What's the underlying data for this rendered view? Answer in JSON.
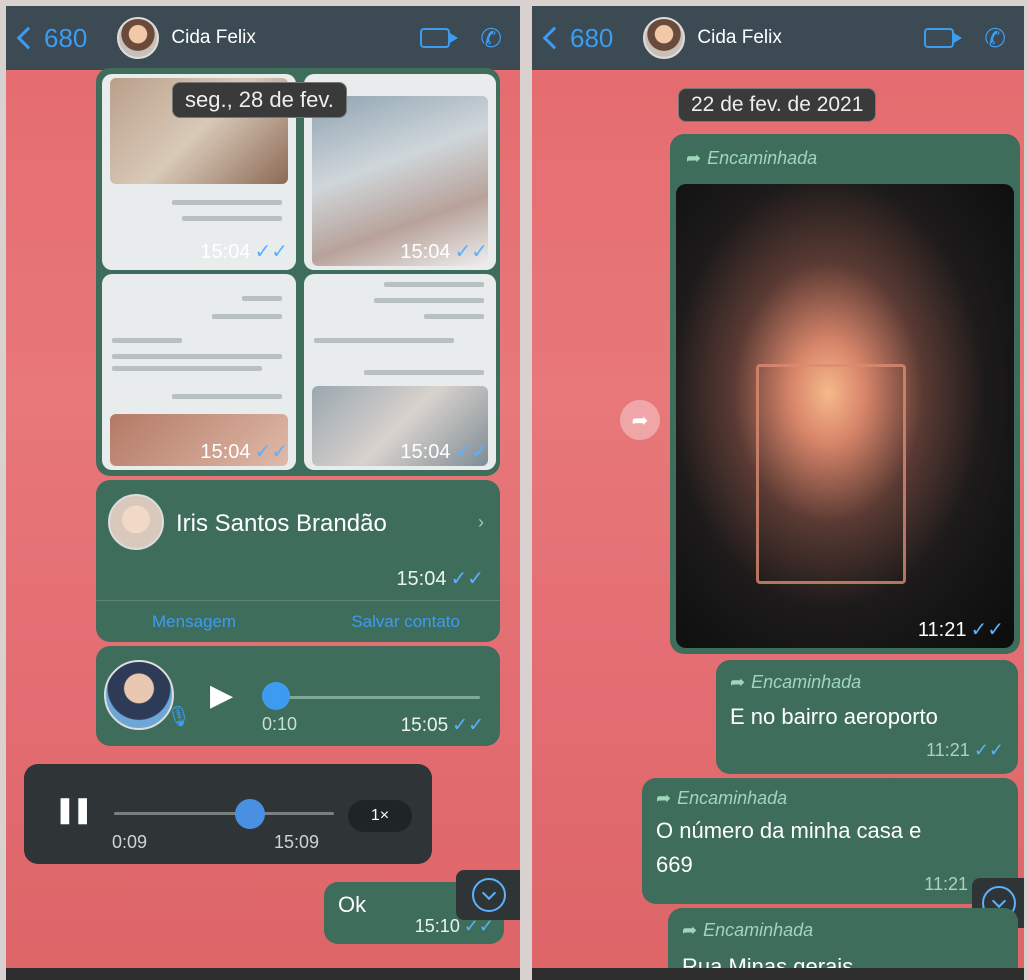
{
  "header": {
    "back_count": "680",
    "contact_name": "Cida Felix"
  },
  "left": {
    "date_pill": "seg., 28 de fev.",
    "grid_times": [
      "15:04",
      "15:04",
      "15:04",
      "15:04"
    ],
    "contact_card": {
      "name": "Iris Santos Brandão",
      "time": "15:04",
      "message_btn": "Mensagem",
      "save_btn": "Salvar contato"
    },
    "voice_in": {
      "duration": "0:10",
      "time": "15:05"
    },
    "voice_out": {
      "elapsed": "0:09",
      "time": "15:09",
      "speed": "1×",
      "progress": 0.62
    },
    "ok_msg": {
      "text": "Ok",
      "time": "15:10"
    }
  },
  "right": {
    "date_pill": "22 de fev. de 2021",
    "forwarded_label": "Encaminhada",
    "photo_time": "11:21",
    "msg1": {
      "text": "E no bairro aeroporto",
      "time": "11:21"
    },
    "msg2": {
      "line1": "O número da minha casa e",
      "line2": "669",
      "time": "11:21"
    },
    "msg3": {
      "text": "Rua Minas gerais"
    }
  },
  "icons": {
    "ticks": "✓✓",
    "forward": "➦",
    "play": "▶",
    "pause": "❚❚"
  },
  "colors": {
    "header": "#3b4a53",
    "bubble_out": "#3f6d5c",
    "bubble_dark": "#2f3537",
    "accent": "#3d9cf0",
    "wallpaper": "#e46a6e"
  }
}
